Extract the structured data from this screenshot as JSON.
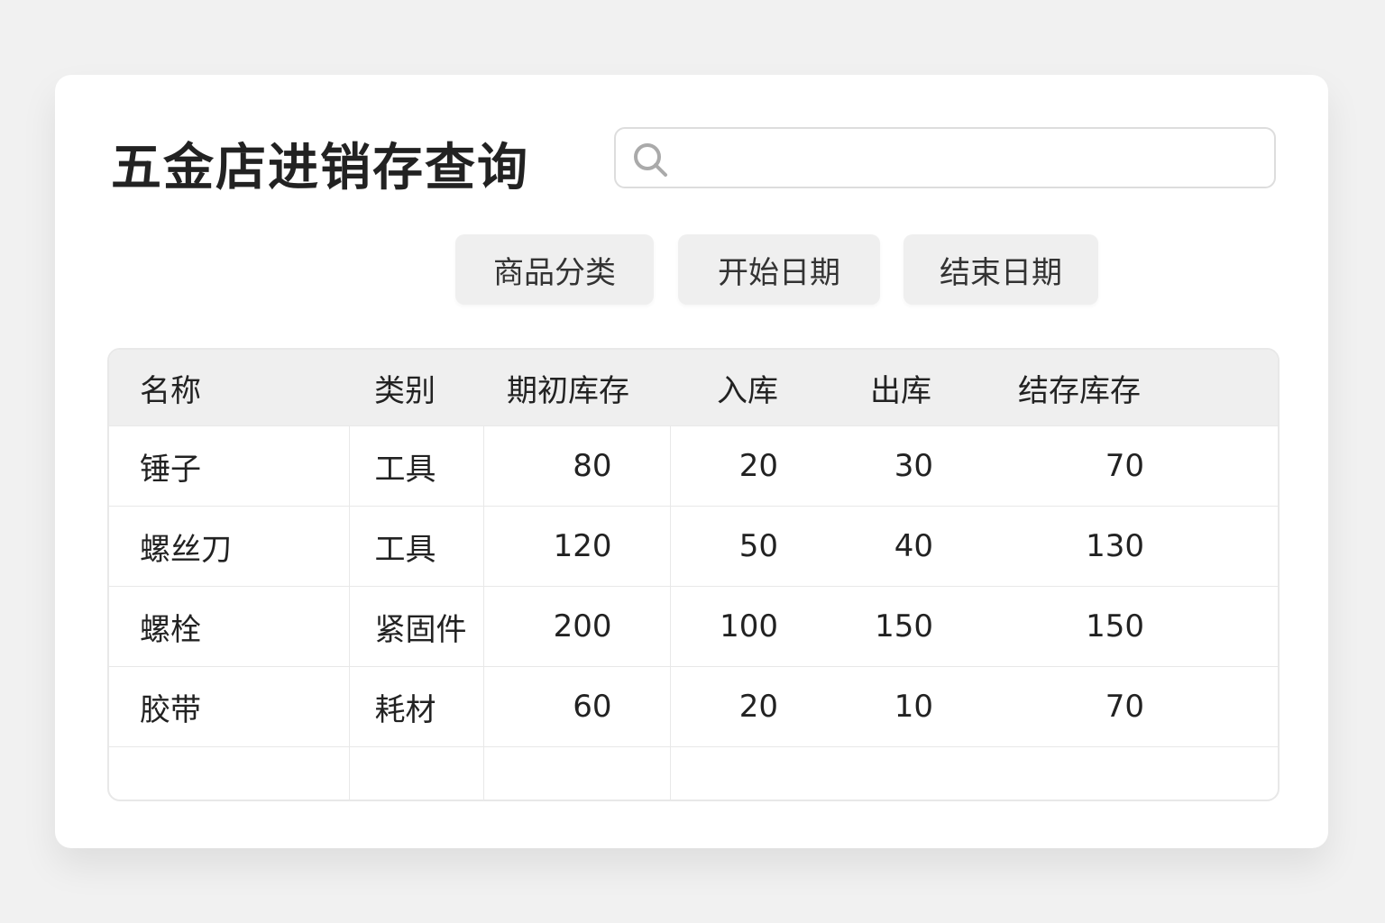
{
  "title": "五金店进销存查询",
  "search": {
    "placeholder": ""
  },
  "filters": [
    "商品分类",
    "开始日期",
    "结束日期"
  ],
  "table": {
    "headers": [
      "名称",
      "类别",
      "期初库存",
      "入库",
      "出库",
      "结存库存"
    ],
    "rows": [
      [
        "锤子",
        "工具",
        "80",
        "20",
        "30",
        "70"
      ],
      [
        "螺丝刀",
        "工具",
        "120",
        "50",
        "40",
        "130"
      ],
      [
        "螺栓",
        "紧固件",
        "200",
        "100",
        "150",
        "150"
      ],
      [
        "胶带",
        "耗材",
        "60",
        "20",
        "10",
        "70"
      ]
    ]
  }
}
